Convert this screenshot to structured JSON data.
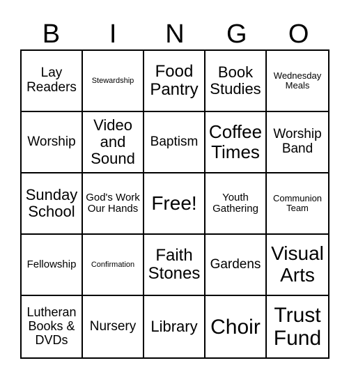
{
  "header": [
    "B",
    "I",
    "N",
    "G",
    "O"
  ],
  "board": [
    [
      "Lay Readers",
      "Stewardship",
      "Food Pantry",
      "Book Studies",
      "Wednesday Meals"
    ],
    [
      "Worship",
      "Video and Sound",
      "Baptism",
      "Coffee Times",
      "Worship Band"
    ],
    [
      "Sunday School",
      "God's Work Our Hands",
      "Free!",
      "Youth Gathering",
      "Communion Team"
    ],
    [
      "Fellowship",
      "Confirmation",
      "Faith Stones",
      "Gardens",
      "Visual Arts"
    ],
    [
      "Lutheran Books & DVDs",
      "Nursery",
      "Library",
      "Choir",
      "Trust Fund"
    ]
  ]
}
